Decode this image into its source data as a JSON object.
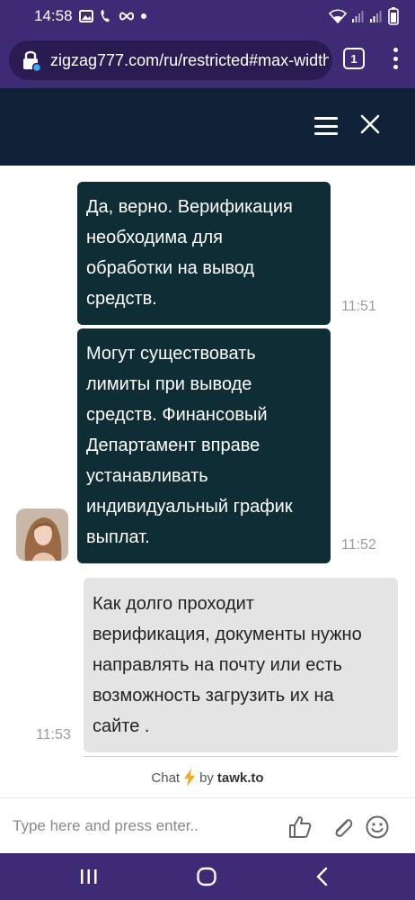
{
  "status_bar": {
    "time": "14:58",
    "left_icons": [
      "image-icon",
      "call-icon",
      "infinity-icon",
      "dot-icon"
    ],
    "right_icons": [
      "wifi-icon",
      "signal-icon",
      "signal-icon",
      "battery-icon"
    ]
  },
  "browser": {
    "url": "zigzag777.com/ru/restricted#max-width",
    "tab_count": "1"
  },
  "chat_header": {
    "icons": [
      "menu-icon",
      "close-icon"
    ]
  },
  "messages": [
    {
      "sender": "agent",
      "lines": [
        "Да, верно. Верификация",
        "необходима для",
        "обработки на вывод",
        "средств."
      ],
      "time": "11:51"
    },
    {
      "sender": "agent",
      "lines": [
        "Могут существовать",
        "лимиты при выводе",
        "средств. Финансовый",
        "Департамент вправе",
        "устанавливать",
        "индивидуальный график",
        "выплат."
      ],
      "time": "11:52"
    },
    {
      "sender": "user",
      "lines": [
        "Как долго проходит",
        "верификация, документы нужно",
        "направлять на почту или есть",
        "возможность загрузить их на",
        "сайте ."
      ],
      "time": "11:53"
    }
  ],
  "footer": {
    "branding_prefix": "Chat",
    "branding_by": "by",
    "branding_name": "tawk.to",
    "input_placeholder": "Type here and press enter..",
    "icons": [
      "thumbs-up-icon",
      "paperclip-icon",
      "emoji-icon"
    ]
  },
  "nav_bar": {
    "icons": [
      "recent-apps-icon",
      "home-icon",
      "back-icon"
    ]
  },
  "colors": {
    "system_bar": "#3f2a75",
    "chat_header": "#0f2238",
    "agent_bubble": "#0e2d35",
    "user_bubble": "#e4e4e4",
    "bolt": "#f5a623"
  }
}
